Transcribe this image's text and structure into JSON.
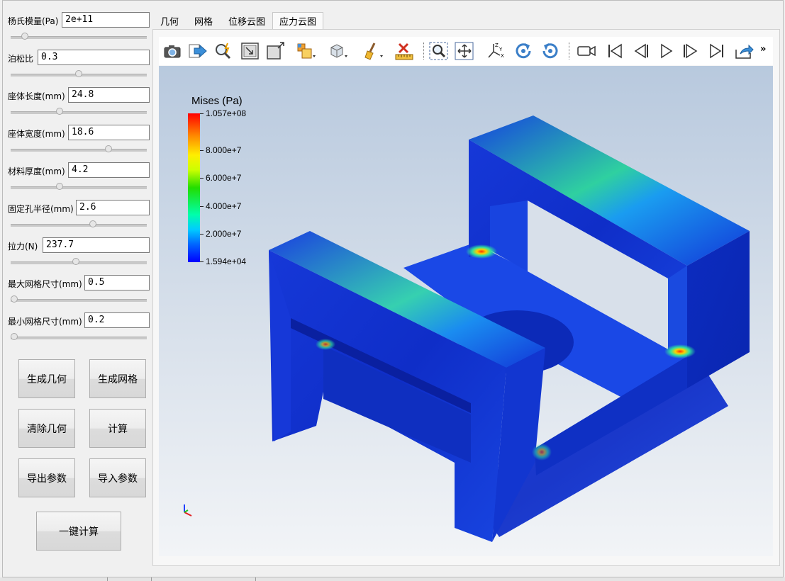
{
  "params": [
    {
      "label": "杨氏模量(Pa)",
      "value": "2e+11",
      "slider": 0.08
    },
    {
      "label": "泊松比",
      "value": "0.3",
      "slider": 0.5
    },
    {
      "label": "座体长度(mm)",
      "value": "24.8",
      "slider": 0.35
    },
    {
      "label": "座体宽度(mm)",
      "value": "18.6",
      "slider": 0.73
    },
    {
      "label": "材料厚度(mm)",
      "value": "4.2",
      "slider": 0.35
    },
    {
      "label": "固定孔半径(mm)",
      "value": "2.6",
      "slider": 0.61
    },
    {
      "label": "拉力(N)",
      "value": "237.7",
      "slider": 0.48
    },
    {
      "label": "最大网格尺寸(mm)",
      "value": "0.5",
      "slider": 0.0
    },
    {
      "label": "最小网格尺寸(mm)",
      "value": "0.2",
      "slider": 0.0
    }
  ],
  "buttons": {
    "gen_geometry": "生成几何",
    "gen_mesh": "生成网格",
    "clear_geometry": "清除几何",
    "compute": "计算",
    "export_params": "导出参数",
    "import_params": "导入参数",
    "one_click": "一键计算"
  },
  "tabs": [
    "几何",
    "网格",
    "位移云图",
    "应力云图"
  ],
  "active_tab": "应力云图",
  "toolbar": {
    "more_label": "»",
    "icons": [
      "camera-icon",
      "export-arrow-icon",
      "zoom-select-icon",
      "fit-view-icon",
      "zoom-window-icon",
      "display-mode-icon",
      "view-style-icon",
      "clear-brush-icon",
      "measure-ruler-icon",
      "zoom-fit-icon",
      "pan-icon",
      "axes-icon",
      "rotate-cw-icon",
      "rotate-ccw-icon",
      "video-camera-icon",
      "skip-first-icon",
      "step-back-icon",
      "play-icon",
      "step-forward-icon",
      "skip-last-icon",
      "share-export-icon"
    ]
  },
  "legend": {
    "title": "Mises (Pa)",
    "labels": [
      "1.057e+08",
      "8.000e+7",
      "6.000e+7",
      "4.000e+7",
      "2.000e+7",
      "1.594e+04"
    ]
  },
  "colors": {
    "colormap_low": "#0000ff",
    "colormap_high": "#ff0000",
    "part_base": "#1a2ecc"
  }
}
